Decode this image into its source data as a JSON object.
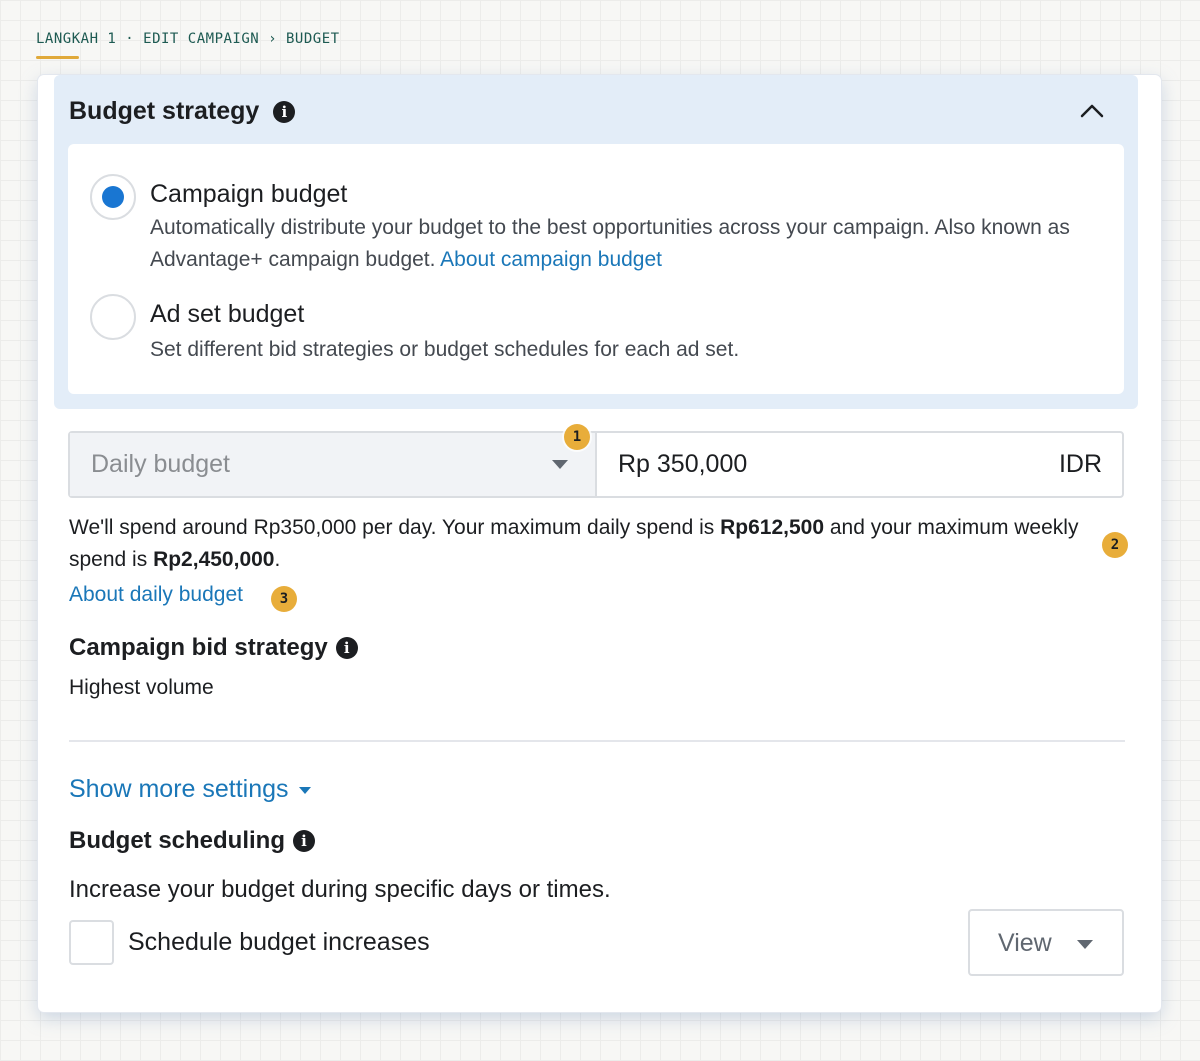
{
  "breadcrumb": "LANGKAH 1 · EDIT CAMPAIGN › BUDGET",
  "strategy": {
    "title": "Budget strategy",
    "options": [
      {
        "label": "Campaign budget",
        "description": "Automatically distribute your budget to the best opportunities across your campaign. Also known as Advantage+ campaign budget.",
        "link": "About campaign budget",
        "selected": true
      },
      {
        "label": "Ad set budget",
        "description": "Set different bid strategies or budget schedules for each ad set.",
        "selected": false
      }
    ]
  },
  "budget": {
    "type_label": "Daily budget",
    "amount": "Rp 350,000",
    "currency": "IDR",
    "spend_prefix": "We'll spend around Rp350,000 per day. Your maximum daily spend is",
    "max_daily": "Rp612,500",
    "spend_middle": "and your maximum weekly spend is",
    "max_weekly": "Rp2,450,000",
    "spend_suffix": ".",
    "about_link": "About daily budget"
  },
  "bid_strategy": {
    "title": "Campaign bid strategy",
    "value": "Highest volume"
  },
  "show_more": "Show more settings",
  "scheduling": {
    "title": "Budget scheduling",
    "description": "Increase your budget during specific days or times.",
    "checkbox_label": "Schedule budget increases",
    "view_label": "View"
  },
  "badges": [
    "1",
    "2",
    "3"
  ],
  "colors": {
    "accent": "#1976d2",
    "link": "#1a77b8",
    "badge": "#e8ad3a",
    "panel": "#e3edf8"
  }
}
